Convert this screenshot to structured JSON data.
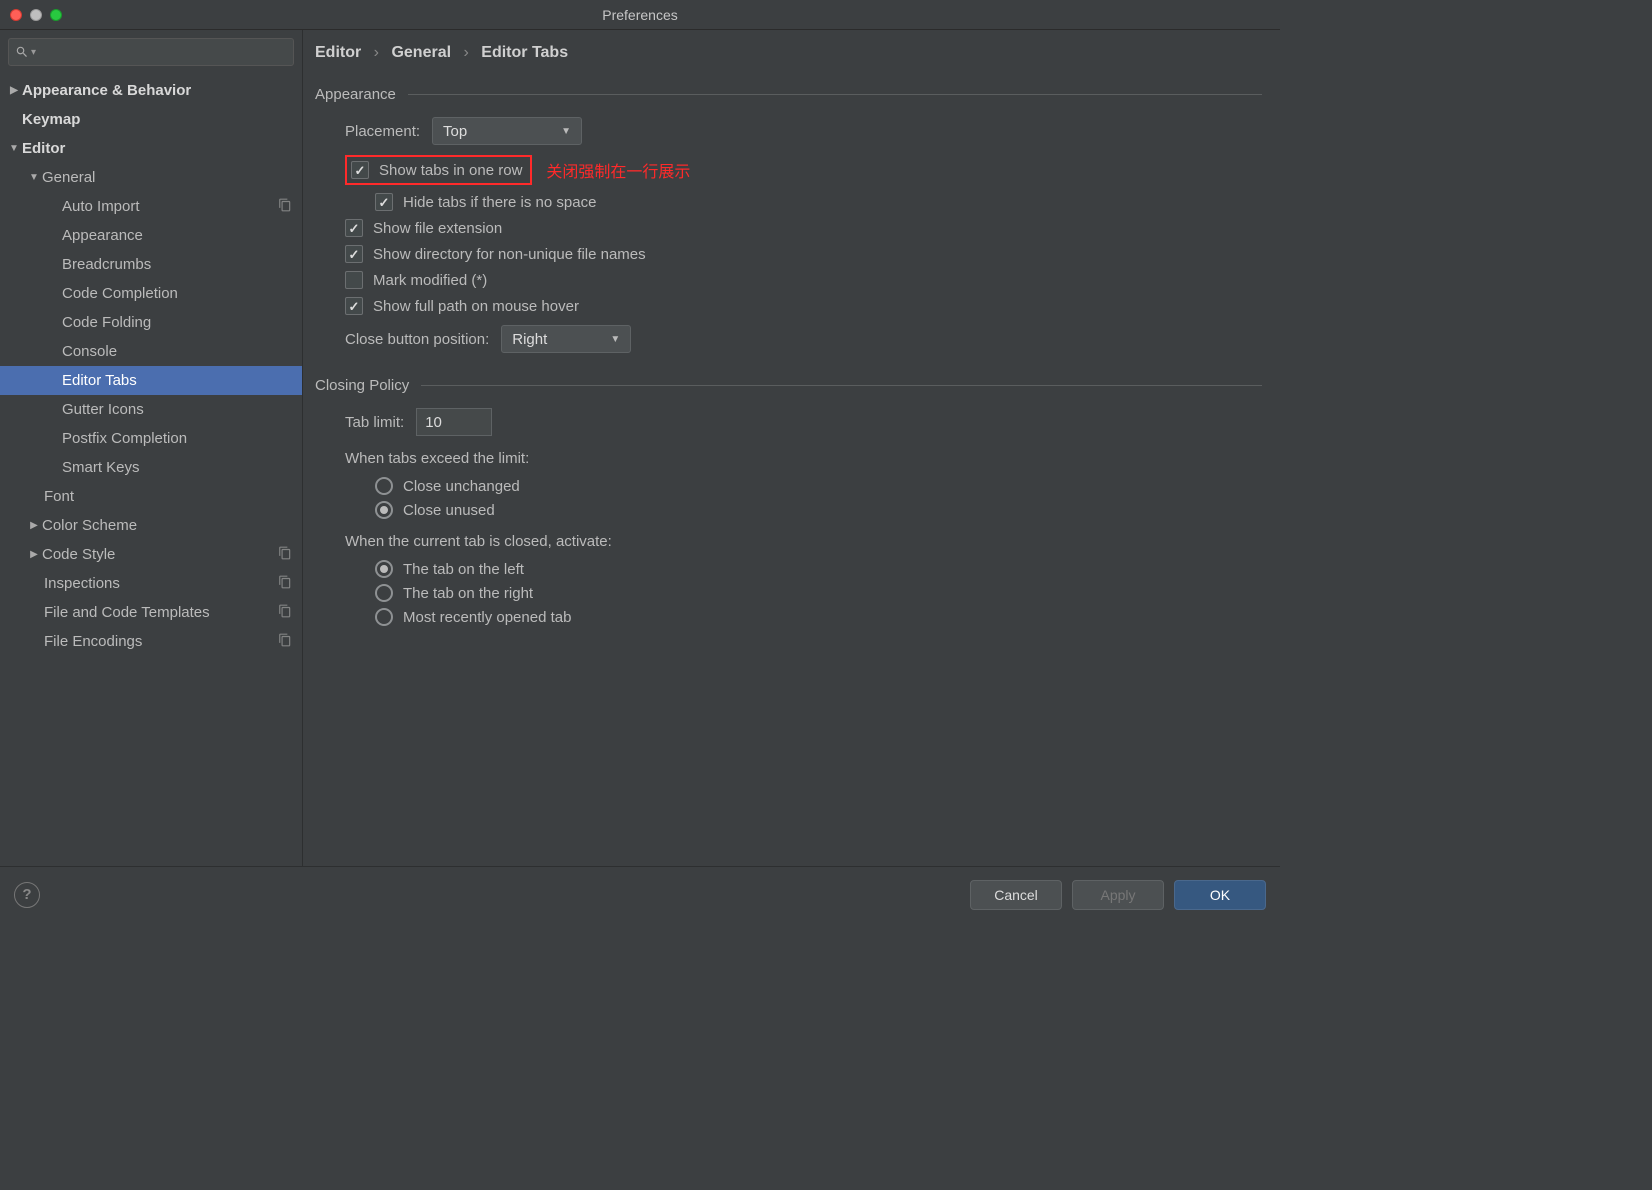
{
  "title": "Preferences",
  "crumbs": {
    "a": "Editor",
    "b": "General",
    "c": "Editor Tabs"
  },
  "tree": {
    "app_behavior": "Appearance & Behavior",
    "keymap": "Keymap",
    "editor": "Editor",
    "general": "General",
    "auto_import": "Auto Import",
    "appearance2": "Appearance",
    "breadcrumbs": "Breadcrumbs",
    "code_completion": "Code Completion",
    "code_folding": "Code Folding",
    "console": "Console",
    "editor_tabs": "Editor Tabs",
    "gutter_icons": "Gutter Icons",
    "postfix": "Postfix Completion",
    "smart_keys": "Smart Keys",
    "font": "Font",
    "color_scheme": "Color Scheme",
    "code_style": "Code Style",
    "inspections": "Inspections",
    "file_templates": "File and Code Templates",
    "file_encodings": "File Encodings"
  },
  "sections": {
    "appearance": "Appearance",
    "closing": "Closing Policy"
  },
  "labels": {
    "placement": "Placement:",
    "placement_val": "Top",
    "show_one_row": "Show tabs in one row",
    "note": "关闭强制在一行展示",
    "hide_tabs": "Hide tabs if there is no space",
    "show_ext": "Show file extension",
    "show_dir": "Show directory for non-unique file names",
    "mark_mod": "Mark modified (*)",
    "show_path": "Show full path on mouse hover",
    "close_pos": "Close button position:",
    "close_pos_val": "Right",
    "tab_limit": "Tab limit:",
    "tab_limit_val": "10",
    "exceed": "When tabs exceed the limit:",
    "close_unchanged": "Close unchanged",
    "close_unused": "Close unused",
    "activate": "When the current tab is closed, activate:",
    "act_left": "The tab on the left",
    "act_right": "The tab on the right",
    "act_recent": "Most recently opened tab"
  },
  "buttons": {
    "cancel": "Cancel",
    "apply": "Apply",
    "ok": "OK"
  }
}
